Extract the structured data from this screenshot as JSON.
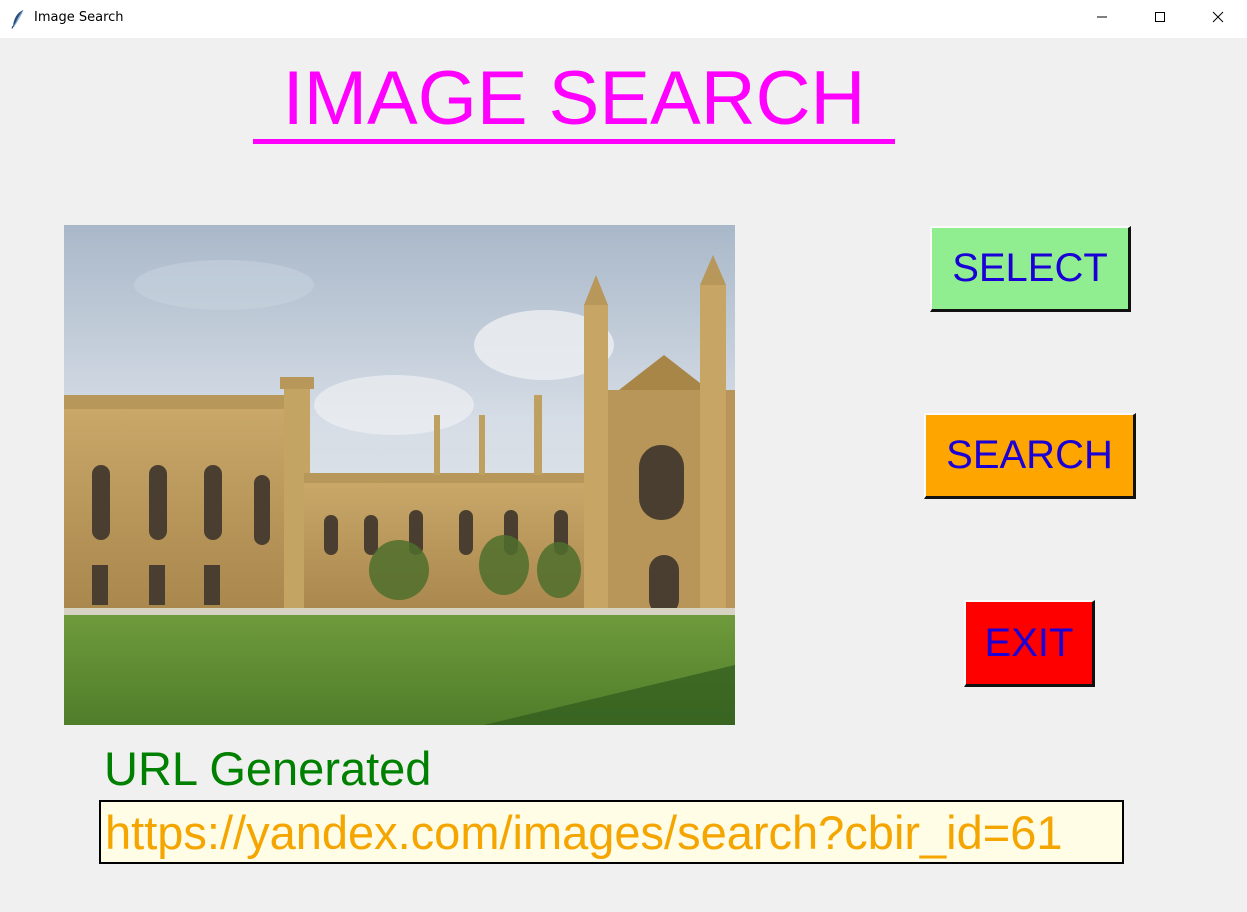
{
  "window": {
    "title": "Image Search",
    "controls": [
      "minimize",
      "maximize",
      "close"
    ]
  },
  "heading": {
    "text": "IMAGE SEARCH",
    "color": "#ff00ff"
  },
  "image_preview": {
    "description_icon": "photo-image"
  },
  "buttons": {
    "select": {
      "label": "SELECT",
      "bg": "#90ee90"
    },
    "search": {
      "label": "SEARCH",
      "bg": "#ffa500"
    },
    "exit": {
      "label": "EXIT",
      "bg": "#ff0000"
    },
    "text_color": "#1a00d6"
  },
  "url_section": {
    "label": "URL Generated",
    "label_color": "#008000",
    "value": "https://yandex.com/images/search?cbir_id=61",
    "value_color": "#f5a500"
  }
}
